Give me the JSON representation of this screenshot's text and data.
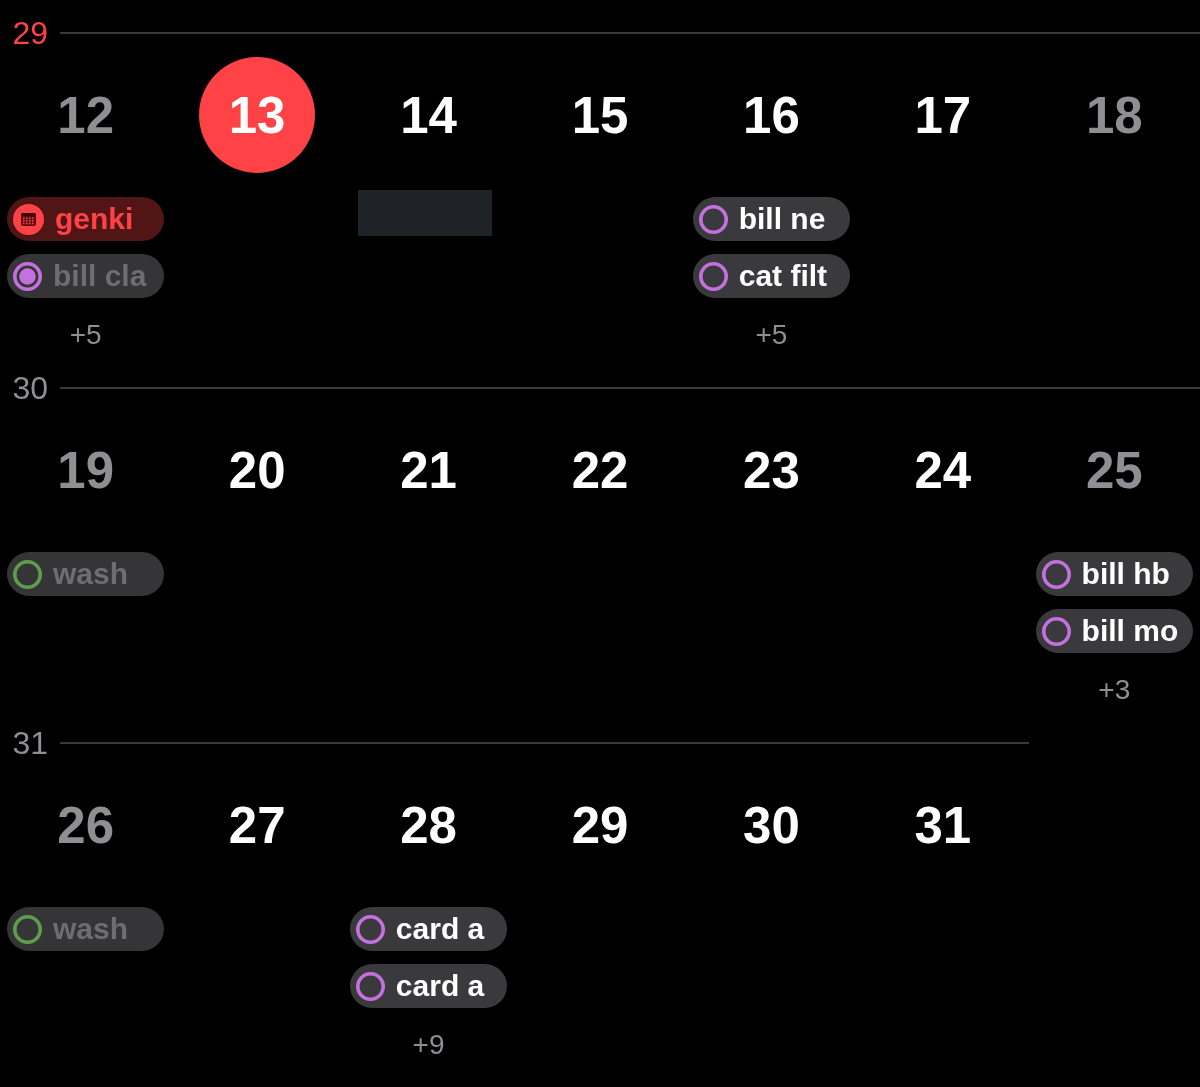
{
  "weeks": [
    {
      "number": "29",
      "current": true,
      "days": [
        {
          "date": "12",
          "weekend": true,
          "today": false,
          "events": [
            {
              "kind": "event",
              "title": "genki",
              "color": "#ff4245"
            },
            {
              "kind": "reminder",
              "title": "bill cla",
              "color": "#c471e0",
              "completed": true,
              "dimmed": true
            }
          ],
          "more": "+5"
        },
        {
          "date": "13",
          "weekend": false,
          "today": true
        },
        {
          "date": "14",
          "weekend": false,
          "today": false,
          "events": [
            {
              "kind": "redacted"
            }
          ]
        },
        {
          "date": "15",
          "weekend": false,
          "today": false
        },
        {
          "date": "16",
          "weekend": false,
          "today": false,
          "events": [
            {
              "kind": "reminder",
              "title": "bill ne",
              "color": "#c471e0",
              "completed": false,
              "dimmed": false
            },
            {
              "kind": "reminder",
              "title": "cat filt",
              "color": "#c471e0",
              "completed": false,
              "dimmed": false
            }
          ],
          "more": "+5"
        },
        {
          "date": "17",
          "weekend": false,
          "today": false
        },
        {
          "date": "18",
          "weekend": true,
          "today": false
        }
      ]
    },
    {
      "number": "30",
      "current": false,
      "days": [
        {
          "date": "19",
          "weekend": true,
          "today": false,
          "events": [
            {
              "kind": "reminder",
              "title": "wash",
              "color": "#5d9e4c",
              "completed": false,
              "dimmed": true
            }
          ]
        },
        {
          "date": "20",
          "weekend": false,
          "today": false
        },
        {
          "date": "21",
          "weekend": false,
          "today": false
        },
        {
          "date": "22",
          "weekend": false,
          "today": false
        },
        {
          "date": "23",
          "weekend": false,
          "today": false
        },
        {
          "date": "24",
          "weekend": false,
          "today": false
        },
        {
          "date": "25",
          "weekend": true,
          "today": false,
          "events": [
            {
              "kind": "reminder",
              "title": "bill hb",
              "color": "#c471e0",
              "completed": false,
              "dimmed": false
            },
            {
              "kind": "reminder",
              "title": "bill mo",
              "color": "#c471e0",
              "completed": false,
              "dimmed": false
            }
          ],
          "more": "+3"
        }
      ]
    },
    {
      "number": "31",
      "current": false,
      "days": [
        {
          "date": "26",
          "weekend": true,
          "today": false,
          "events": [
            {
              "kind": "reminder",
              "title": "wash",
              "color": "#5d9e4c",
              "completed": false,
              "dimmed": true
            }
          ]
        },
        {
          "date": "27",
          "weekend": false,
          "today": false
        },
        {
          "date": "28",
          "weekend": false,
          "today": false,
          "events": [
            {
              "kind": "reminder",
              "title": "card a",
              "color": "#c471e0",
              "completed": false,
              "dimmed": false
            },
            {
              "kind": "reminder",
              "title": "card a",
              "color": "#c471e0",
              "completed": false,
              "dimmed": false
            }
          ],
          "more": "+9"
        },
        {
          "date": "29",
          "weekend": false,
          "today": false
        },
        {
          "date": "30",
          "weekend": false,
          "today": false
        },
        {
          "date": "31",
          "weekend": false,
          "today": false
        }
      ]
    }
  ]
}
